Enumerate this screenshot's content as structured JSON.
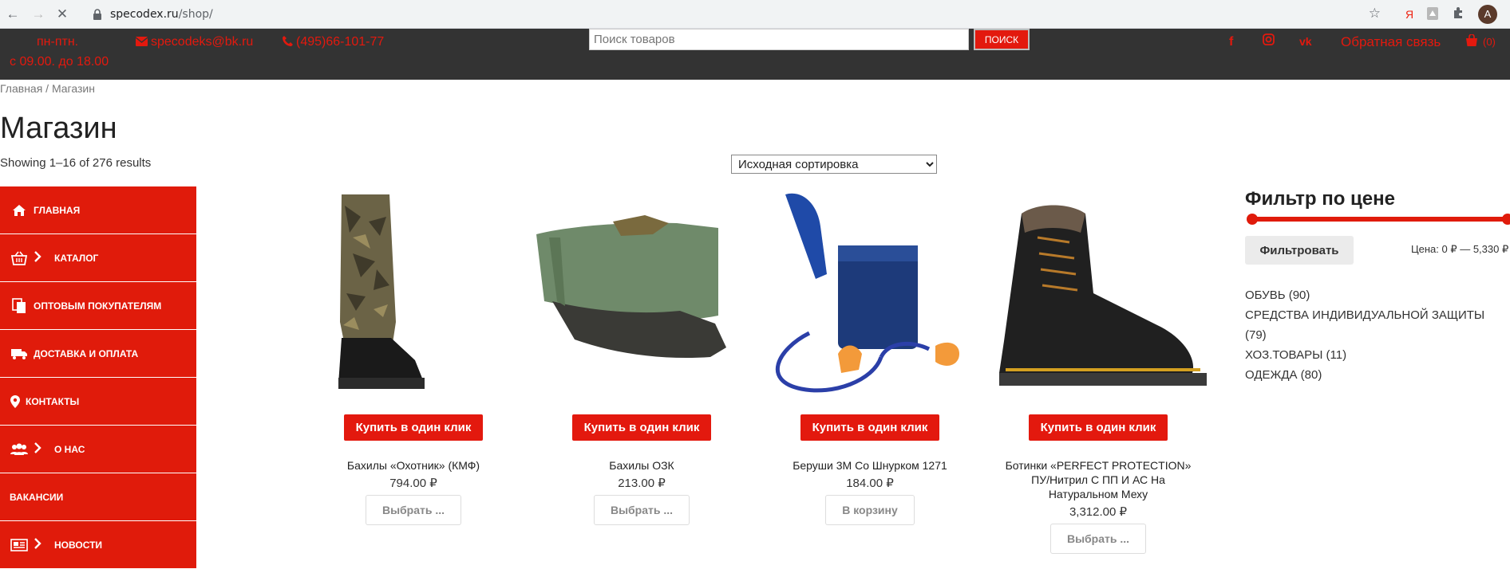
{
  "browser": {
    "url": "specodex.ru/shop/",
    "url_host": "specodex.ru",
    "url_path": "/shop/",
    "avatar_letter": "A"
  },
  "header": {
    "hours_line1": "пн-птн.",
    "hours_line2": "с 09.00. до 18.00",
    "email": "specodeks@bk.ru",
    "phone": "(495)66-101-77",
    "search_placeholder": "Поиск товаров",
    "search_button": "ПОИСК",
    "feedback": "Обратная связь",
    "cart_count": "(0)"
  },
  "breadcrumb": "Главная / Магазин",
  "page_title": "Магазин",
  "results_text": "Showing 1–16 of 276 results",
  "sort": {
    "selected": "Исходная сортировка"
  },
  "sidebar": {
    "items": [
      {
        "label": "ГЛАВНАЯ",
        "icon": "home-icon",
        "chevron": false
      },
      {
        "label": "КАТАЛОГ",
        "icon": "basket-icon",
        "chevron": true
      },
      {
        "label": "ОПТОВЫМ ПОКУПАТЕЛЯМ",
        "icon": "documents-icon",
        "chevron": false
      },
      {
        "label": "ДОСТАВКА И ОПЛАТА",
        "icon": "truck-icon",
        "chevron": false
      },
      {
        "label": "КОНТАКТЫ",
        "icon": "map-pin-icon",
        "chevron": false
      },
      {
        "label": "О НАС",
        "icon": "users-icon",
        "chevron": true
      },
      {
        "label": "ВАКАНСИИ",
        "icon": "",
        "chevron": false
      },
      {
        "label": "НОВОСТИ",
        "icon": "newspaper-icon",
        "chevron": true
      }
    ]
  },
  "products": [
    {
      "name": "Бахилы «Охотник» (КМФ)",
      "price": "794.00 ₽",
      "buy_label": "Купить в один клик",
      "action_label": "Выбрать ..."
    },
    {
      "name": "Бахилы ОЗК",
      "price": "213.00 ₽",
      "buy_label": "Купить в один клик",
      "action_label": "Выбрать ..."
    },
    {
      "name": "Беруши 3М Со Шнурком 1271",
      "price": "184.00 ₽",
      "buy_label": "Купить в один клик",
      "action_label": "В корзину"
    },
    {
      "name": "Ботинки «PERFECT PROTECTION» ПУ/Нитрил С ПП И АС На Натуральном Меху",
      "price": "3,312.00 ₽",
      "buy_label": "Купить в один клик",
      "action_label": "Выбрать ..."
    }
  ],
  "filter": {
    "title": "Фильтр по цене",
    "button": "Фильтровать",
    "price_range": "Цена: 0 ₽ — 5,330 ₽"
  },
  "categories": [
    "ОБУВЬ (90)",
    "СРЕДСТВА ИНДИВИДУАЛЬНОЙ ЗАЩИТЫ (79)",
    "ХОЗ.ТОВАРЫ (11)",
    "ОДЕЖДА (80)"
  ],
  "colors": {
    "accent": "#e3190e",
    "menu": "#e01b0b",
    "topbar": "#333333"
  }
}
